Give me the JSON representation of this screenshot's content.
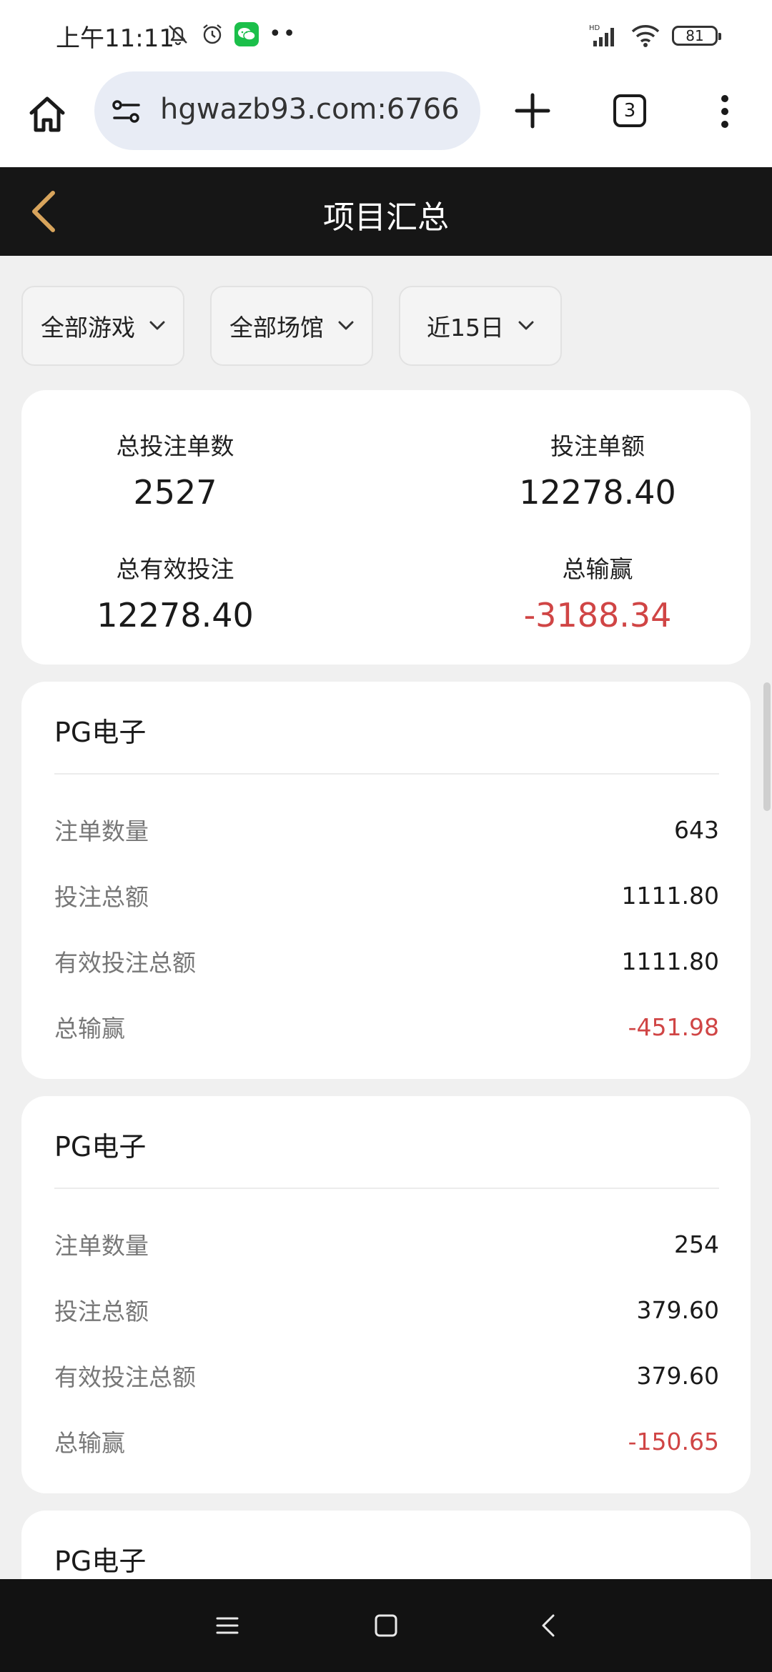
{
  "status_bar": {
    "time": "上午11:11",
    "battery": "81"
  },
  "browser": {
    "url": "hgwazb93.com:6766",
    "tab_count": "3"
  },
  "header": {
    "title": "项目汇总"
  },
  "filters": [
    {
      "label": "全部游戏"
    },
    {
      "label": "全部场馆"
    },
    {
      "label": "近15日"
    }
  ],
  "summary": {
    "total_bets_label": "总投注单数",
    "total_bets_value": "2527",
    "bet_amount_label": "投注单额",
    "bet_amount_value": "12278.40",
    "valid_bets_label": "总有效投注",
    "valid_bets_value": "12278.40",
    "win_loss_label": "总输赢",
    "win_loss_value": "-3188.34"
  },
  "row_labels": {
    "count": "注单数量",
    "amount": "投注总额",
    "valid": "有效投注总额",
    "win_loss": "总输赢"
  },
  "games": [
    {
      "name": "PG电子",
      "count": "643",
      "amount": "1111.80",
      "valid": "1111.80",
      "win_loss": "-451.98"
    },
    {
      "name": "PG电子",
      "count": "254",
      "amount": "379.60",
      "valid": "379.60",
      "win_loss": "-150.65"
    },
    {
      "name": "PG电子"
    }
  ],
  "colors": {
    "accent_gold": "#d8a45c",
    "negative_red": "#d04545",
    "header_bg": "#161616"
  }
}
